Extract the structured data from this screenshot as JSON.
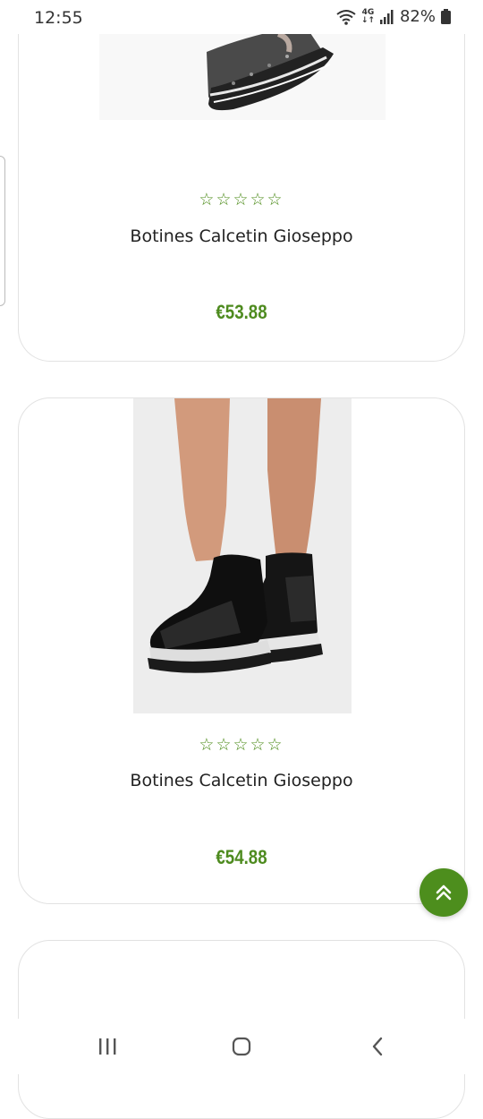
{
  "status_bar": {
    "time": "12:55",
    "network": "4G",
    "battery": "82%"
  },
  "products": [
    {
      "name": "Botines Calcetin Gioseppo",
      "price": "€53.88",
      "rating_stars": "☆☆☆☆☆"
    },
    {
      "name": "Botines Calcetin Gioseppo",
      "price": "€54.88",
      "rating_stars": "☆☆☆☆☆"
    }
  ],
  "colors": {
    "accent": "#4d8e1d",
    "price": "#4e8b1f",
    "card_border": "#e2e2e2"
  },
  "icons": {
    "fab": "double-chevron-up-icon",
    "nav_recent": "recent-apps-icon",
    "nav_home": "home-icon",
    "nav_back": "back-icon"
  }
}
